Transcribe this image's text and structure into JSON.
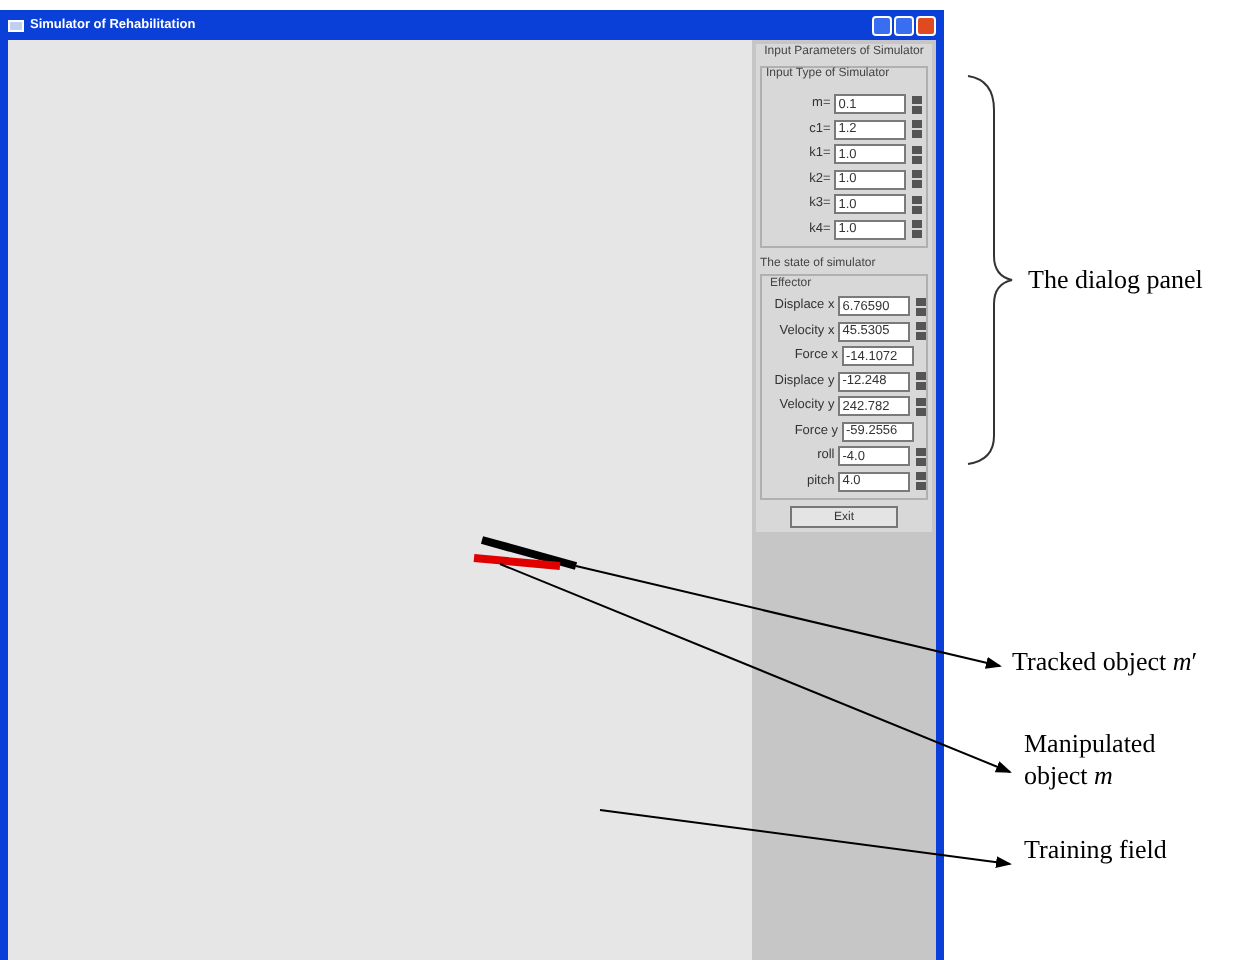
{
  "window": {
    "title": "Simulator of Rehabilitation"
  },
  "parameters": {
    "title": "Input Parameters of Simulator",
    "group_title": "Input Type of Simulator",
    "fields": [
      {
        "label": "m=",
        "value": "0.1",
        "spinner": true
      },
      {
        "label": "c1=",
        "value": "1.2",
        "spinner": true
      },
      {
        "label": "k1=",
        "value": "1.0",
        "spinner": true
      },
      {
        "label": "k2=",
        "value": "1.0",
        "spinner": true
      },
      {
        "label": "k3=",
        "value": "1.0",
        "spinner": true
      },
      {
        "label": "k4=",
        "value": "1.0",
        "spinner": true
      }
    ]
  },
  "state": {
    "title": "The state of simulator",
    "group_title": "Effector",
    "fields": [
      {
        "label": "Displace x",
        "value": "6.76590",
        "spinner": true
      },
      {
        "label": "Velocity x",
        "value": "45.5305",
        "spinner": true
      },
      {
        "label": "Force x",
        "value": "-14.1072",
        "spinner": false
      },
      {
        "label": "Displace y",
        "value": "-12.248",
        "spinner": true
      },
      {
        "label": "Velocity y",
        "value": "242.782",
        "spinner": true
      },
      {
        "label": "Force y",
        "value": "-59.2556",
        "spinner": false
      },
      {
        "label": "roll",
        "value": "-4.0",
        "spinner": true
      },
      {
        "label": "pitch",
        "value": "4.0",
        "spinner": true
      }
    ]
  },
  "exit_button": "Exit",
  "annotations": [
    {
      "kind": "brace",
      "label": "The dialog panel"
    },
    {
      "kind": "arrow",
      "label": "Tracked object *m*′"
    },
    {
      "kind": "arrow",
      "label": "Manipulated object *m*"
    },
    {
      "kind": "arrow",
      "label": "Training field"
    }
  ]
}
